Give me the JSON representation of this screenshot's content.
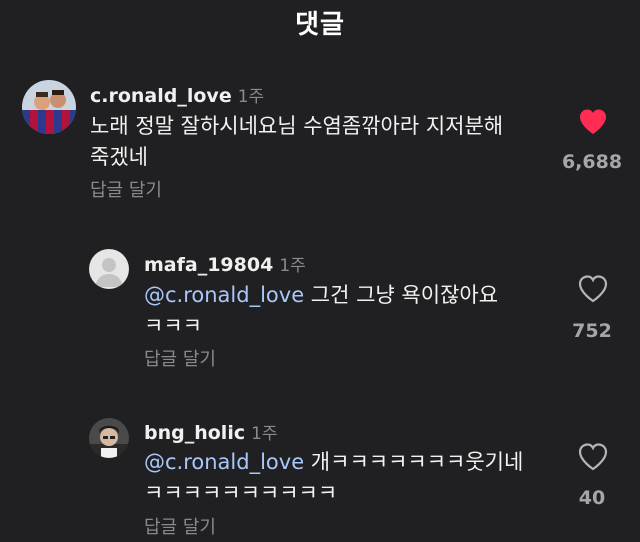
{
  "header": {
    "title": "댓글"
  },
  "comments": [
    {
      "username": "c.ronald_love",
      "time": "1주",
      "text_line1": "노래 정말 잘하시네요님 수염좀깎아라 지저분해",
      "text_line2": "죽겠네",
      "reply_label": "답글 달기",
      "likes": "6,688",
      "liked": true
    },
    {
      "username": "mafa_19804",
      "time": "1주",
      "mention": "@c.ronald_love",
      "text_line1_rest": " 그건 그냥 욕이잖아요",
      "text_line2": "ㅋㅋㅋ",
      "reply_label": "답글 달기",
      "likes": "752",
      "liked": false
    },
    {
      "username": "bng_holic",
      "time": "1주",
      "mention": "@c.ronald_love",
      "text_line1_rest": " 개ㅋㅋㅋㅋㅋㅋㅋ웃기네",
      "text_line2": "ㅋㅋㅋㅋㅋㅋㅋㅋㅋㅋ",
      "reply_label": "답글 달기",
      "likes": "40",
      "liked": false
    }
  ],
  "colors": {
    "background": "#202022",
    "heart_liked": "#ff2d55",
    "mention": "#a8c7fa",
    "muted": "#8a8a8e"
  },
  "icons": [
    "heart-filled-icon",
    "heart-outline-icon"
  ]
}
